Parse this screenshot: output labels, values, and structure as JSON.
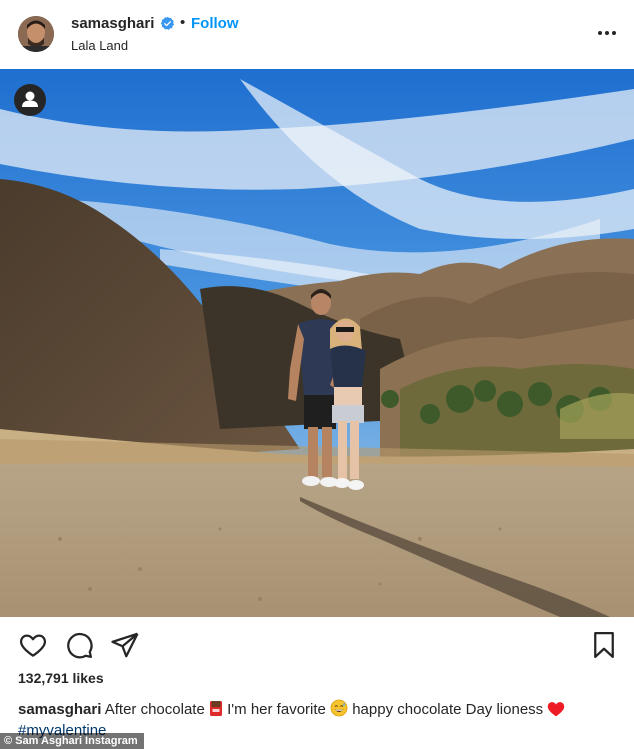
{
  "post": {
    "username": "samasghari",
    "follow_label": "Follow",
    "dot": "•",
    "location": "Lala Land",
    "likes": "132,791 likes",
    "caption": {
      "username": "samasghari",
      "text_1": "After chocolate",
      "emoji_1": "chocolate-bar-icon",
      "text_2": "I'm her favorite",
      "emoji_2": "grinning-sweat-icon",
      "text_3": "happy chocolate Day lioness",
      "emoji_3": "red-heart-icon",
      "hashtag": "#myvalentine"
    }
  },
  "credit": "© Sam Asghari Instagram",
  "colors": {
    "follow": "#0095f6",
    "verified": "#3897f0",
    "text": "#262626",
    "hashtag": "#00376b",
    "heart": "#ed1c24"
  }
}
